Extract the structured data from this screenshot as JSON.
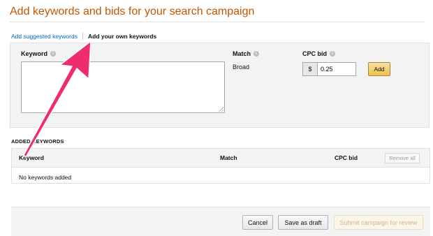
{
  "page": {
    "title": "Add keywords and bids for your search campaign"
  },
  "tabs": {
    "suggested": "Add suggested keywords",
    "own": "Add your own keywords"
  },
  "form": {
    "keyword_label": "Keyword",
    "match_label": "Match",
    "match_value": "Broad",
    "cpc_label": "CPC bid",
    "currency": "$",
    "cpc_value": "0.25",
    "add_label": "Add"
  },
  "added": {
    "heading": "ADDED KEYWORDS",
    "columns": [
      "Keyword",
      "Match",
      "CPC bid"
    ],
    "remove_all_label": "Remove all",
    "empty_text": "No keywords added"
  },
  "footer": {
    "cancel_label": "Cancel",
    "save_draft_label": "Save as draft",
    "submit_label": "Submit campaign for review"
  },
  "colors": {
    "title": "#c45500",
    "link": "#0066c0",
    "primary_button": "#f0c14b",
    "annotation_arrow": "#ee2d6f"
  },
  "icons": {
    "info": "info-icon",
    "annotation": "pink-arrow-annotation"
  }
}
